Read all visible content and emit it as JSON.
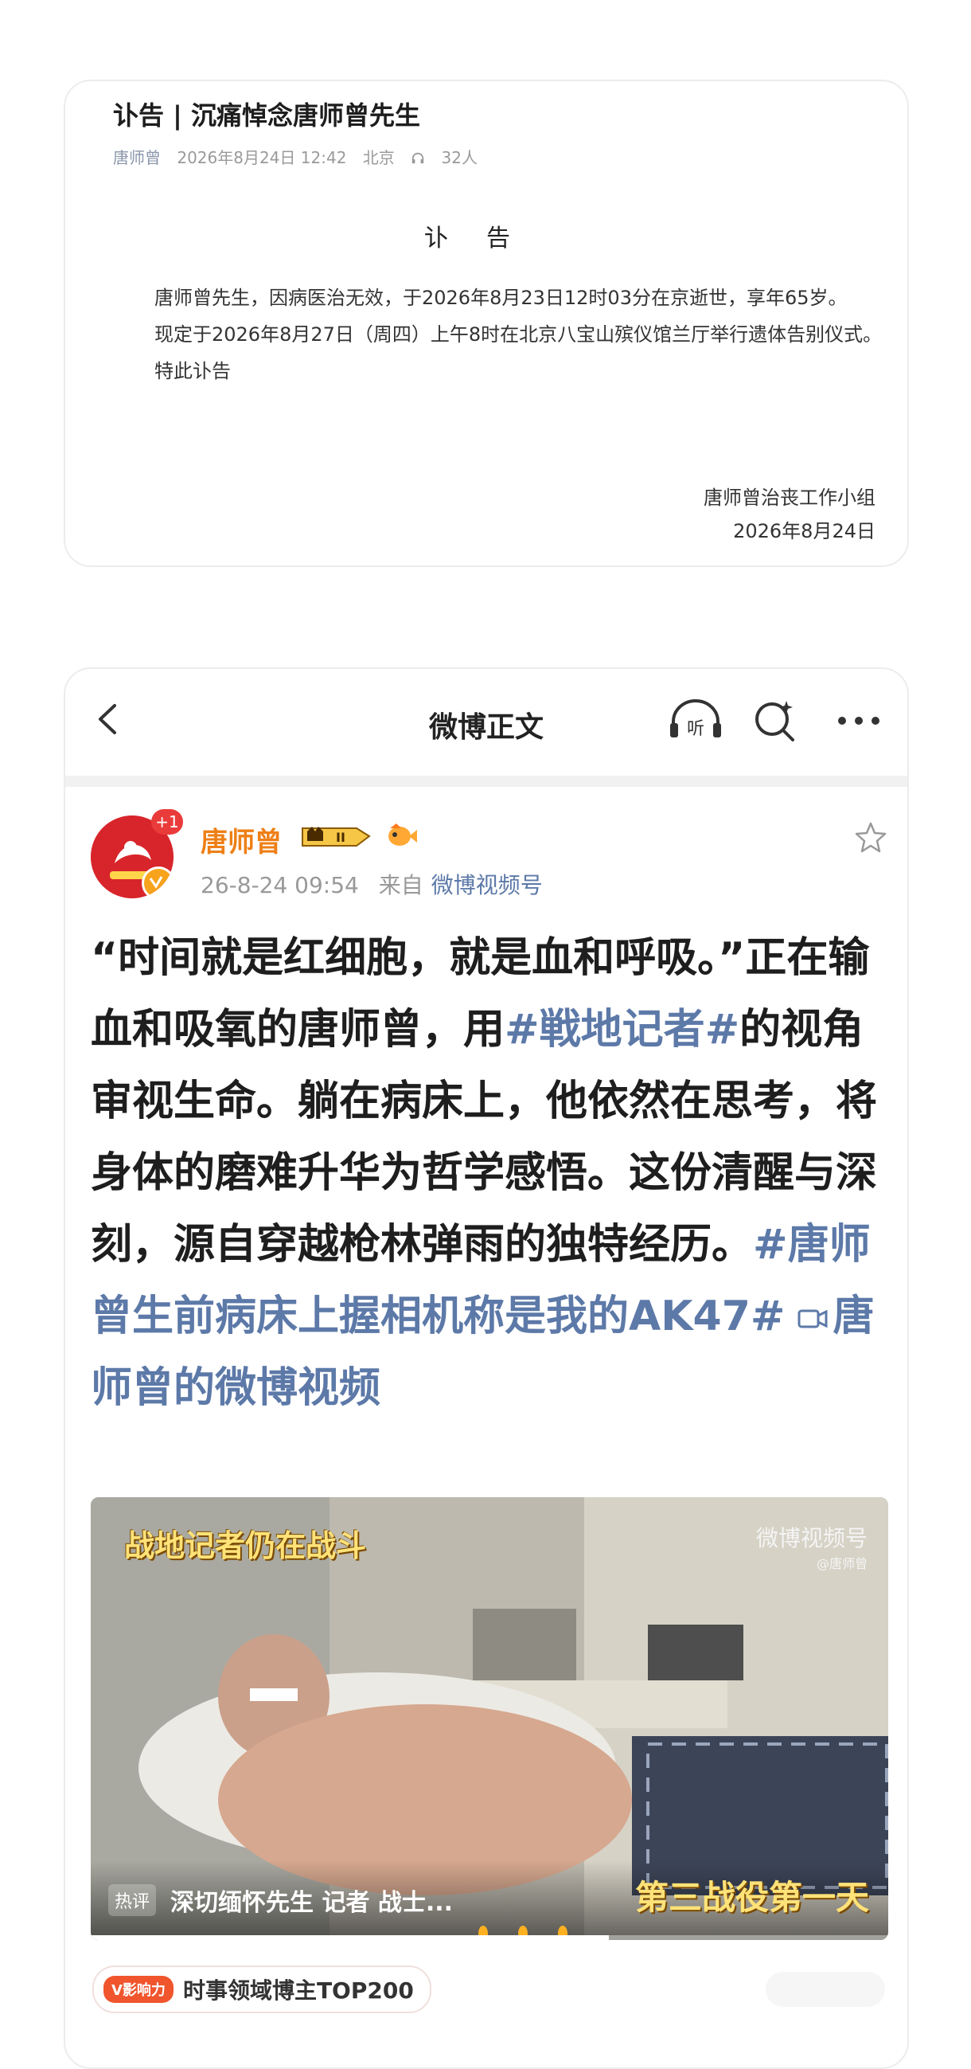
{
  "notice": {
    "title": "讣告 | 沉痛悼念唐师曾先生",
    "author": "唐师曾",
    "datetime": "2026年8月24日 12:42",
    "location": "北京",
    "listeners": "32人",
    "heading": "讣告",
    "para1": "唐师曾先生，因病医治无效，于2026年8月23日12时03分在京逝世，享年65岁。",
    "para2": "现定于2026年8月27日（周四）上午8时在北京八宝山殡仪馆兰厅举行遗体告别仪式。",
    "para3": "特此讣告",
    "sign_org": "唐师曾治丧工作小组",
    "sign_date": "2026年8月24日"
  },
  "weibo": {
    "page_title": "微博正文",
    "avatar_badge": "+1",
    "username": "唐师曾",
    "rank": "II",
    "post_time": "26-8-24 09:54",
    "source_prefix": "来自",
    "source": "微博视频号",
    "text_1": "“时间就是红细胞，就是血和呼吸。”正在输血和吸氧的唐师曾，用",
    "tag_1": "#戦地记者#",
    "text_2": "的视角审视生命。躺在病床上，他依然在思考，将身体的磨难升华为哲学感悟。这份清醒与深刻，源自穿越枪林弹雨的独特经历。",
    "tag_2": "#唐师曾生前病床上握相机称是我的AK47#",
    "video_link": "唐师曾的微博视频",
    "video": {
      "caption_top": "战地记者仍在战斗",
      "watermark": "微博视频号",
      "watermark_sub": "@唐师曾",
      "hot_label": "热评",
      "hot_text": "深切缅怀先生 记者 战士...",
      "caption_bottom": "第三战役第一天",
      "progress": 0.65
    },
    "influence_pill": "V影响力",
    "influence_text": "时事领域博主TOP200"
  }
}
